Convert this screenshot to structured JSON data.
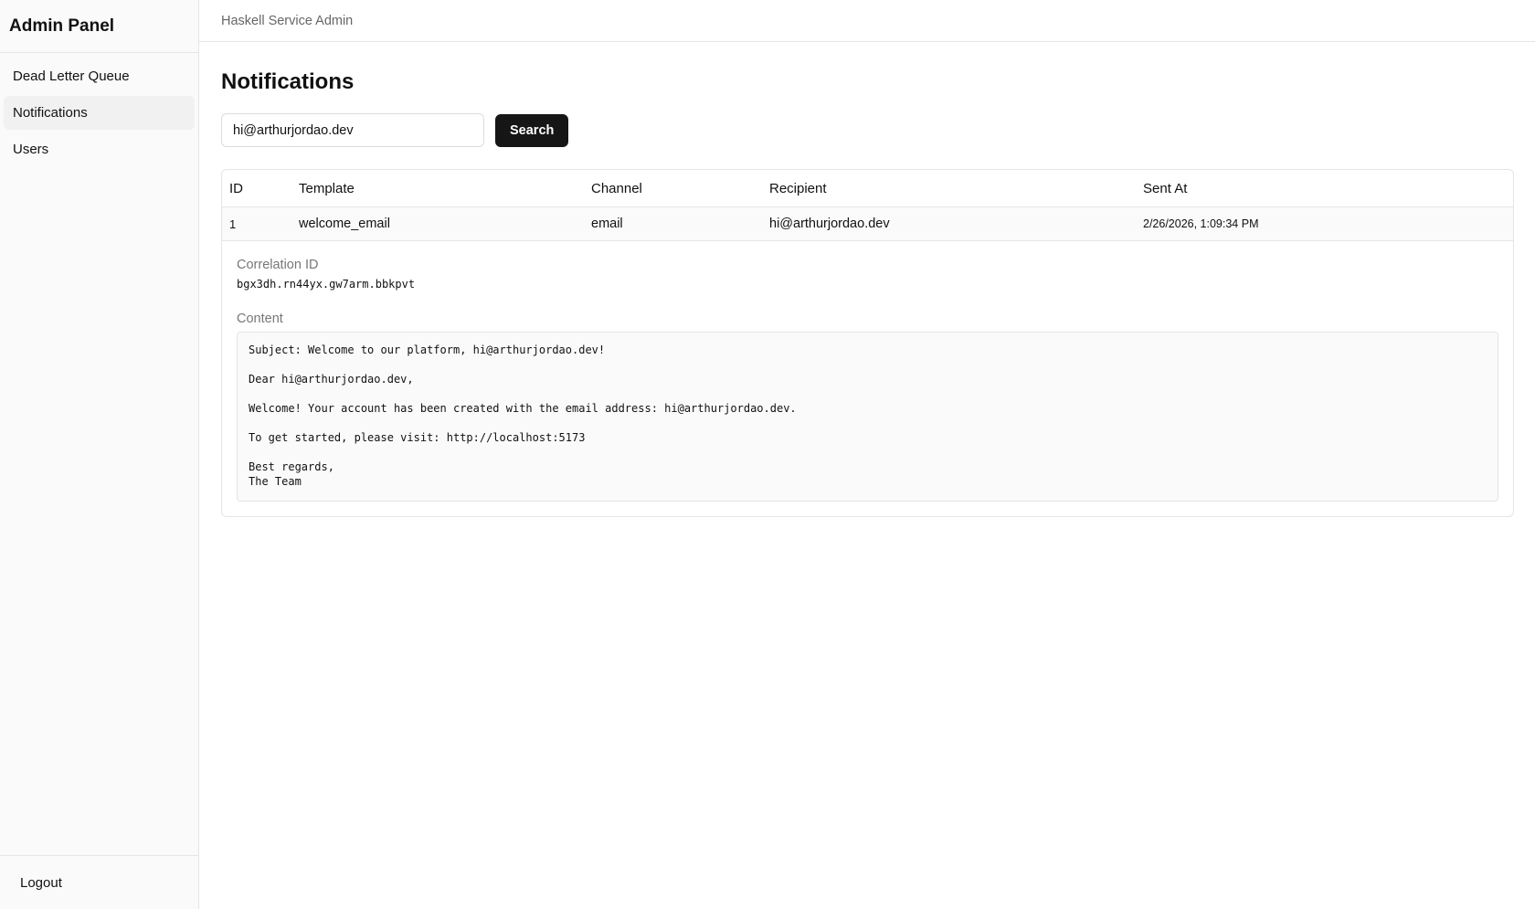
{
  "sidebar": {
    "brand": "Admin Panel",
    "items": [
      {
        "label": "Dead Letter Queue"
      },
      {
        "label": "Notifications"
      },
      {
        "label": "Users"
      }
    ],
    "logout_label": "Logout"
  },
  "topbar": {
    "title": "Haskell Service Admin"
  },
  "page": {
    "title": "Notifications"
  },
  "search": {
    "value": "hi@arthurjordao.dev",
    "button_label": "Search"
  },
  "table": {
    "headers": {
      "id": "ID",
      "template": "Template",
      "channel": "Channel",
      "recipient": "Recipient",
      "sent_at": "Sent At"
    },
    "rows": [
      {
        "id": "1",
        "template": "welcome_email",
        "channel": "email",
        "recipient": "hi@arthurjordao.dev",
        "sent_at": "2/26/2026, 1:09:34 PM"
      }
    ]
  },
  "details": {
    "correlation_label": "Correlation ID",
    "correlation_id": "bgx3dh.rn44yx.gw7arm.bbkpvt",
    "content_label": "Content",
    "content": "Subject: Welcome to our platform, hi@arthurjordao.dev!\n\nDear hi@arthurjordao.dev,\n\nWelcome! Your account has been created with the email address: hi@arthurjordao.dev.\n\nTo get started, please visit: http://localhost:5173\n\nBest regards,\nThe Team"
  }
}
